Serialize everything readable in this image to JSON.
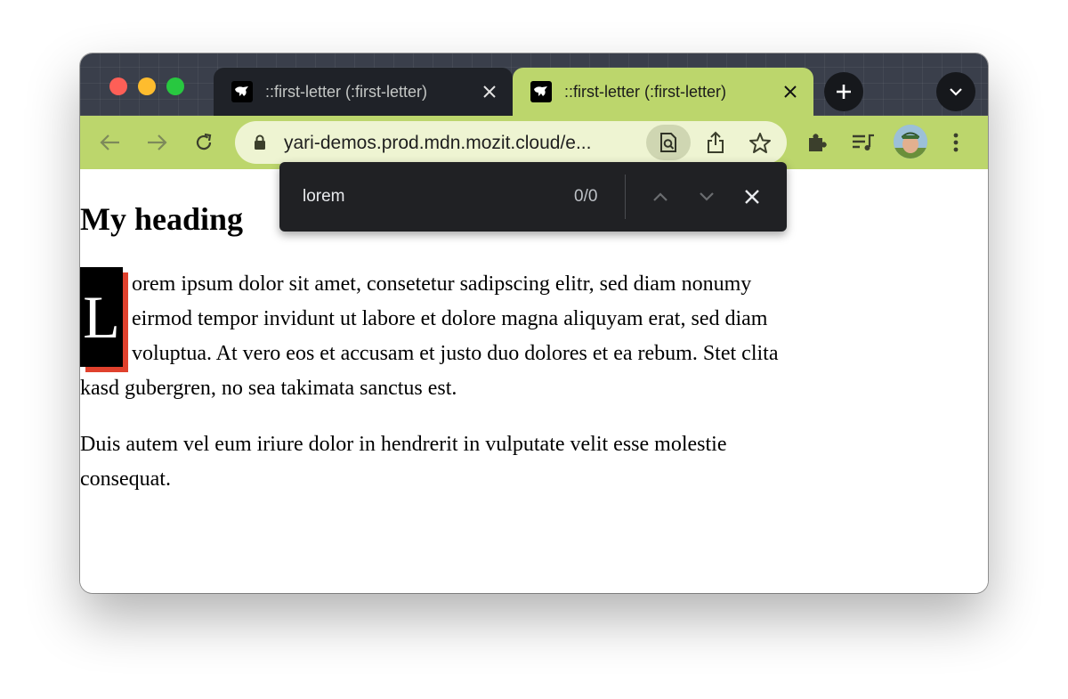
{
  "browser": {
    "tabs": [
      {
        "title": "::first-letter (:first-letter)",
        "active": false
      },
      {
        "title": "::first-letter (:first-letter)",
        "active": true
      }
    ],
    "theme_color": "#bcd66c",
    "url": "yari-demos.prod.mdn.mozit.cloud/e..."
  },
  "find_bar": {
    "query": "lorem",
    "count": "0/0"
  },
  "page": {
    "heading": "My heading",
    "paragraph1_first_letter": "L",
    "paragraph1_rest": "orem ipsum dolor sit amet, consetetur sadipscing elitr, sed diam nonumy eirmod tempor invidunt ut labore et dolore magna aliquyam erat, sed diam voluptua. At vero eos et accusam et justo duo dolores et ea rebum. Stet clita kasd gubergren, no sea takimata sanctus est.",
    "paragraph2": "Duis autem vel eum iriure dolor in hendrerit in vulputate velit esse molestie consequat.",
    "dropcap_shadow_color": "#e0412d"
  }
}
